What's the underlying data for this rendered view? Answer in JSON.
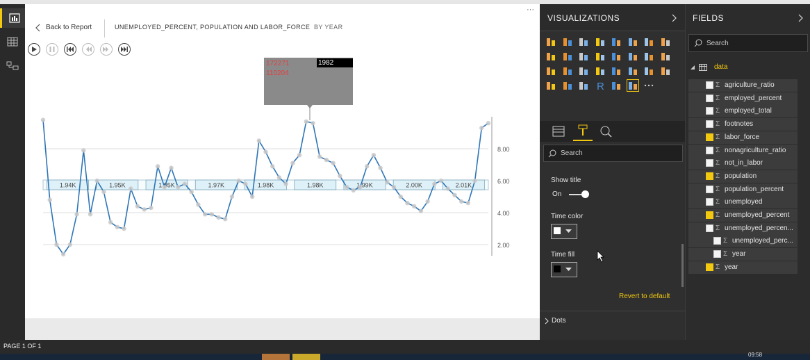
{
  "canvas": {
    "back_label": "Back to Report",
    "title": "UNEMPLOYED_PERCENT, POPULATION AND LABOR_FORCE",
    "subtitle": "BY YEAR",
    "more_label": "···"
  },
  "play_axis": {
    "buttons": [
      "play",
      "pause",
      "first",
      "previous",
      "next",
      "last"
    ]
  },
  "tooltip": {
    "year": "1982",
    "value1": "172271",
    "value2": "110204"
  },
  "chart_data": {
    "type": "line",
    "y_ticks": [
      "8.00",
      "6.00",
      "4.00",
      "2.00"
    ],
    "band_labels": [
      "1.94K",
      "1.95K",
      "1.95K",
      "1.97K",
      "1.98K",
      "1.98K",
      "1.99K",
      "2.00K",
      "2.01K"
    ],
    "line_color": "#2e75b6",
    "series": [
      {
        "values": [
          9.8,
          4.8,
          2.0,
          1.4,
          2.0,
          3.9,
          7.9,
          3.9,
          6.0,
          5.3,
          3.4,
          3.1,
          3.0,
          5.5,
          4.4,
          4.2,
          4.3,
          6.9,
          5.6,
          6.8,
          5.6,
          5.8,
          5.3,
          4.5,
          3.9,
          3.9,
          3.7,
          3.6,
          5.0,
          6.0,
          5.8,
          5.0,
          8.5,
          7.8,
          6.9,
          6.2,
          5.8,
          7.1,
          7.6,
          9.7,
          9.6,
          7.5,
          7.3,
          7.1,
          6.3,
          5.6,
          5.4,
          5.6,
          6.9,
          7.6,
          6.8,
          5.9,
          5.6,
          5.0,
          4.6,
          4.4,
          4.1,
          4.7,
          5.8,
          6.0,
          5.5,
          5.1,
          4.7,
          4.6,
          6.0,
          9.3,
          9.6
        ]
      }
    ]
  },
  "visualizations": {
    "title": "VISUALIZATIONS",
    "search_placeholder": "Search",
    "show_title_label": "Show title",
    "toggle_label": "On",
    "time_color_label": "Time color",
    "time_fill_label": "Time fill",
    "revert_label": "Revert to default",
    "dots_label": "Dots"
  },
  "fields": {
    "title": "FIELDS",
    "search_placeholder": "Search",
    "table_name": "data",
    "items": [
      {
        "label": "agriculture_ratio",
        "checked": false,
        "indent": 0
      },
      {
        "label": "employed_percent",
        "checked": false,
        "indent": 0
      },
      {
        "label": "employed_total",
        "checked": false,
        "indent": 0
      },
      {
        "label": "footnotes",
        "checked": false,
        "indent": 0
      },
      {
        "label": "labor_force",
        "checked": true,
        "indent": 0
      },
      {
        "label": "nonagriculture_ratio",
        "checked": false,
        "indent": 0
      },
      {
        "label": "not_in_labor",
        "checked": false,
        "indent": 0
      },
      {
        "label": "population",
        "checked": true,
        "indent": 0
      },
      {
        "label": "population_percent",
        "checked": false,
        "indent": 0
      },
      {
        "label": "unemployed",
        "checked": false,
        "indent": 0
      },
      {
        "label": "unemployed_percent",
        "checked": true,
        "indent": 0
      },
      {
        "label": "unemployed_percen...",
        "checked": false,
        "indent": 0
      },
      {
        "label": "unemployed_perc...",
        "checked": false,
        "indent": 1
      },
      {
        "label": "year",
        "checked": false,
        "indent": 1
      },
      {
        "label": "year",
        "checked": true,
        "indent": 0
      }
    ]
  },
  "status": {
    "page_label": "PAGE 1 OF 1",
    "clock": "09:58"
  },
  "colors": {
    "accent": "#f2c811",
    "line": "#2e75b6",
    "tooltip_red": "#e04040"
  }
}
